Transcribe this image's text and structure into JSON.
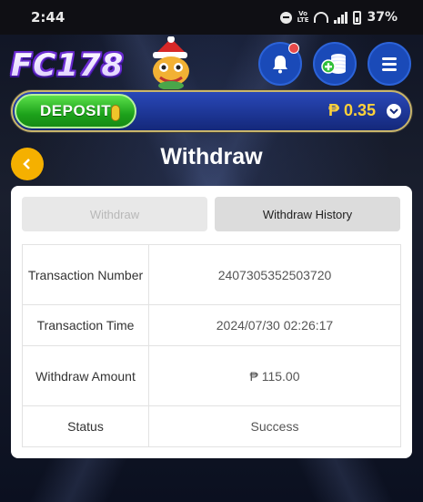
{
  "status_bar": {
    "time": "2:44",
    "network": "LTE",
    "battery": "37%"
  },
  "header": {
    "logo_text": "FC178"
  },
  "deposit": {
    "button_label": "DEPOSIT",
    "balance": "₱ 0.35"
  },
  "page": {
    "title": "Withdraw"
  },
  "tabs": {
    "withdraw": "Withdraw",
    "history": "Withdraw History"
  },
  "details": [
    {
      "label": "Transaction Number",
      "value": "2407305352503720"
    },
    {
      "label": "Transaction Time",
      "value": "2024/07/30 02:26:17"
    },
    {
      "label": "Withdraw Amount",
      "value": "₱ 115.00"
    },
    {
      "label": "Status",
      "value": "Success"
    }
  ],
  "colors": {
    "accent_gold": "#f5b000",
    "balance_gold": "#ffd23a",
    "deposit_green": "#1da21b",
    "header_blue": "#1a4ab8"
  }
}
